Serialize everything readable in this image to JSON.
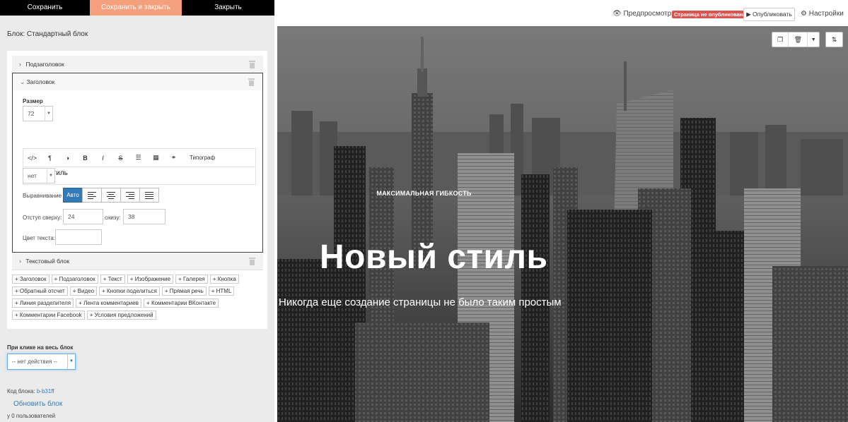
{
  "editor": {
    "topbar": {
      "save": "Сохранить",
      "save_close": "Сохранить и закрыть",
      "close": "Закрыть"
    },
    "block_title": "Блок: Стандартный блок",
    "sections": {
      "subtitle": "Подзаголовок",
      "heading": "Заголовок",
      "textblock": "Текстовый блок"
    },
    "heading_settings": {
      "size_label": "Размер",
      "size_value": "72",
      "rte_typograph": "Типограф",
      "rte_text": "Новый стиль",
      "style_value": "нет",
      "align_label": "Выравнивание",
      "align_auto": "Авто",
      "padding_top_label": "Отступ сверху:",
      "padding_top_value": "24",
      "padding_bottom_label": "снизу:",
      "padding_bottom_value": "38",
      "text_color_label": "Цвет текста:"
    },
    "add_elements": [
      "+ Заголовок",
      "+ Подзаголовок",
      "+ Текст",
      "+ Изображение",
      "+ Галерея",
      "+ Кнопка",
      "+ Обратный отсчет",
      "+ Видео",
      "+ Кнопки поделиться",
      "+ Прямая речь",
      "+ HTML",
      "+ Линия разделителя",
      "+ Лента комментариев",
      "+ Комментарии ВКонтакте",
      "+ Комментарии Facebook",
      "+ Условия предложений"
    ],
    "onclick": {
      "label": "При клике на весь блок",
      "value": "-- нет действия --"
    },
    "code_label": "Код блока:",
    "code_value": "b-b31ff",
    "refresh": "Обновить блок",
    "users": "у 0 пользователей"
  },
  "preview": {
    "nav": {
      "preview": "Предпросмотр",
      "status": "Страница не опубликована",
      "publish": "Опубликовать",
      "settings": "Настройки"
    },
    "hero": {
      "kicker": "МАКСИМАЛЬНАЯ ГИБКОСТЬ",
      "title": "Новый стиль",
      "subtitle": "Никогда еще создание страницы не было таким простым"
    }
  },
  "colors": {
    "accent": "#f4a07c",
    "status_red": "#d9534f",
    "link": "#337ab7",
    "active": "#337ab7"
  }
}
